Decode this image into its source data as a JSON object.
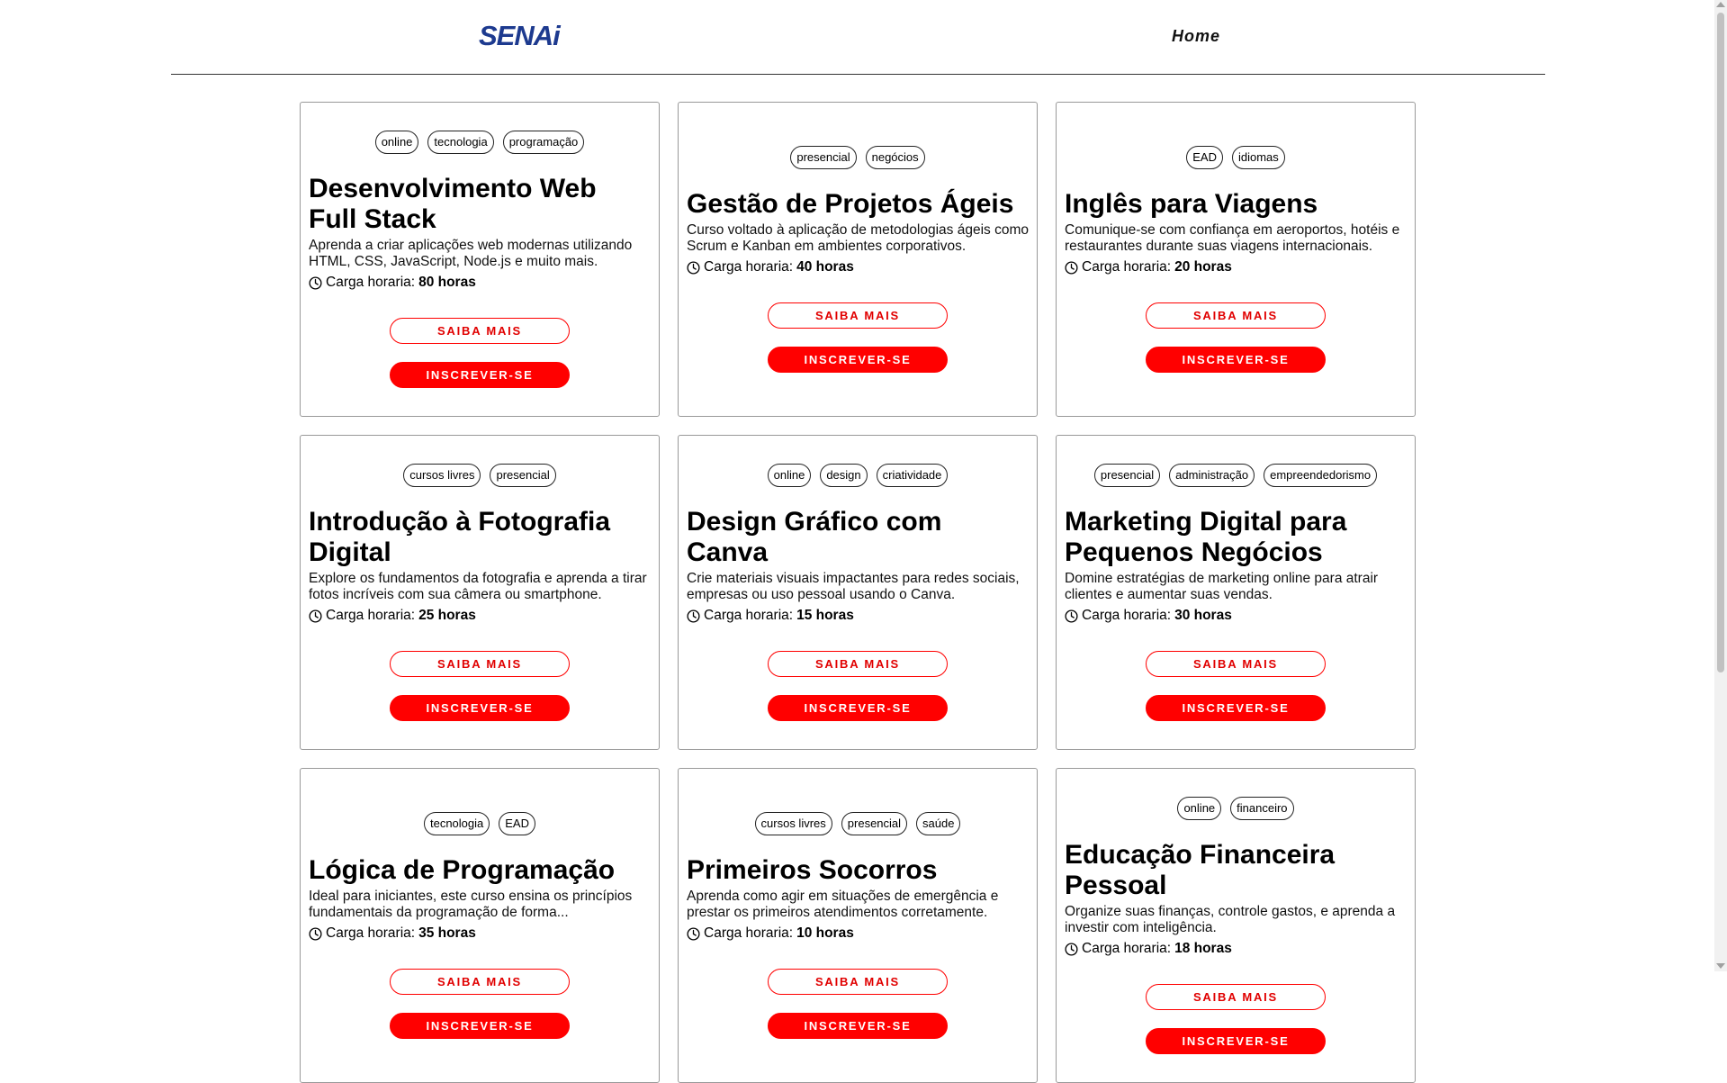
{
  "header": {
    "logo_text": "SENAi",
    "nav_home": "Home"
  },
  "buttons": {
    "saiba_mais": "Saiba mais",
    "inscrever": "Inscrever-se"
  },
  "hours_label": "Carga horaria:",
  "colors": {
    "brand_blue": "#1d3a8f",
    "accent_red": "#ff0000"
  },
  "cards": [
    {
      "tags": [
        "online",
        "tecnologia",
        "programação"
      ],
      "title": "Desenvolvimento Web Full Stack",
      "description": "Aprenda a criar aplicações web modernas utilizando HTML, CSS, JavaScript, Node.js e muito mais.",
      "hours": "80 horas"
    },
    {
      "tags": [
        "presencial",
        "negócios"
      ],
      "title": "Gestão de Projetos Ágeis",
      "description": "Curso voltado à aplicação de metodologias ágeis como Scrum e Kanban em ambientes corporativos.",
      "hours": "40 horas"
    },
    {
      "tags": [
        "EAD",
        "idiomas"
      ],
      "title": "Inglês para Viagens",
      "description": "Comunique-se com confiança em aeroportos, hotéis e restaurantes durante suas viagens internacionais.",
      "hours": "20 horas"
    },
    {
      "tags": [
        "cursos livres",
        "presencial"
      ],
      "title": "Introdução à Fotografia Digital",
      "description": "Explore os fundamentos da fotografia e aprenda a tirar fotos incríveis com sua câmera ou smartphone.",
      "hours": "25 horas"
    },
    {
      "tags": [
        "online",
        "design",
        "criatividade"
      ],
      "title": "Design Gráfico com Canva",
      "description": "Crie materiais visuais impactantes para redes sociais, empresas ou uso pessoal usando o Canva.",
      "hours": "15 horas"
    },
    {
      "tags": [
        "presencial",
        "administração",
        "empreendedorismo"
      ],
      "title": "Marketing Digital para Pequenos Negócios",
      "description": "Domine estratégias de marketing online para atrair clientes e aumentar suas vendas.",
      "hours": "30 horas"
    },
    {
      "tags": [
        "tecnologia",
        "EAD"
      ],
      "title": "Lógica de Programação",
      "description": "Ideal para iniciantes, este curso ensina os princípios fundamentais da programação de forma...",
      "hours": "35 horas"
    },
    {
      "tags": [
        "cursos livres",
        "presencial",
        "saúde"
      ],
      "title": "Primeiros Socorros",
      "description": "Aprenda como agir em situações de emergência e prestar os primeiros atendimentos corretamente.",
      "hours": "10 horas"
    },
    {
      "tags": [
        "online",
        "financeiro"
      ],
      "title": "Educação Financeira Pessoal",
      "description": "Organize suas finanças, controle gastos, e aprenda a investir com inteligência.",
      "hours": "18 horas"
    }
  ]
}
